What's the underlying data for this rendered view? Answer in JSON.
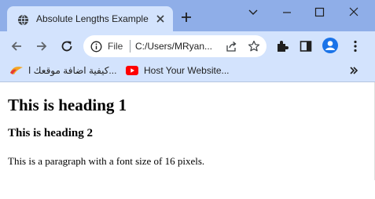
{
  "browser": {
    "tab": {
      "title": "Absolute Lengths Example"
    },
    "address_bar": {
      "scheme_label": "File",
      "url": "C:/Users/MRyan..."
    },
    "bookmarks": [
      {
        "label": "كيفية اضافة موقعك ا...",
        "icon": "bookmark-favicon"
      },
      {
        "label": "Host Your Website...",
        "icon": "youtube-icon"
      }
    ],
    "colors": {
      "frame": "#8faee8",
      "toolbar": "#d3e3fd",
      "avatar": "#1a73e8",
      "youtube": "#ff0000"
    }
  },
  "page": {
    "heading1": "This is heading 1",
    "heading2": "This is heading 2",
    "paragraph": "This is a paragraph with a font size of 16 pixels."
  }
}
